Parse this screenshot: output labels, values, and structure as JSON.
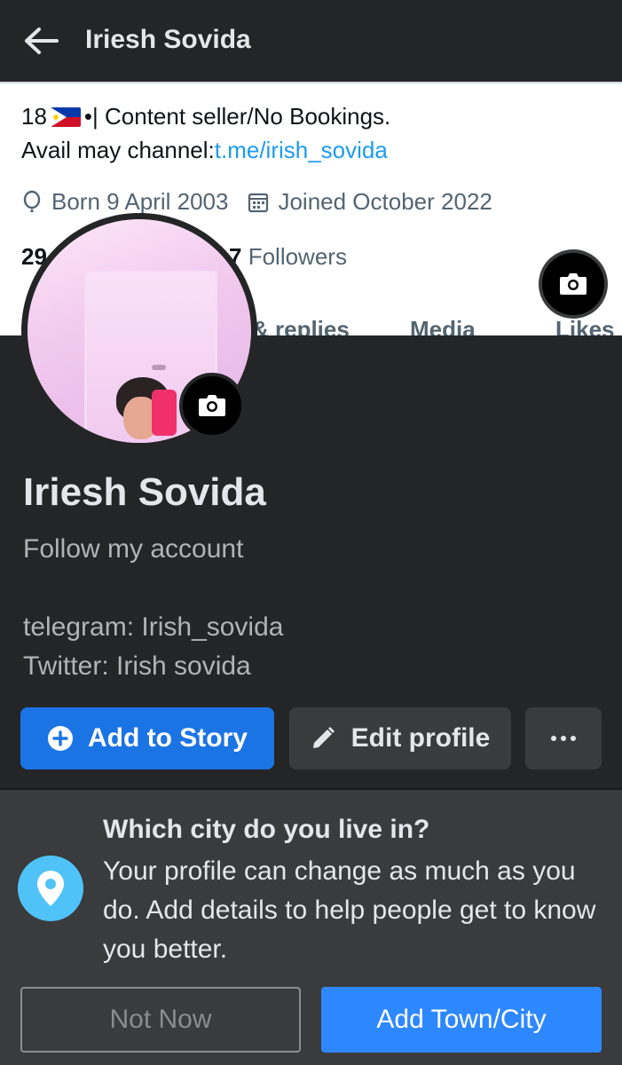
{
  "header": {
    "title": "Iriesh Sovida"
  },
  "twitter_embed": {
    "bio_line1_prefix": "18",
    "bio_line1_suffix": "•| Content seller/No Bookings.",
    "bio_line2_text": "Avail may channel:",
    "bio_line2_link": "t.me/irish_sovida",
    "born": "Born 9 April 2003",
    "joined": "Joined October 2022",
    "following_partial": "29",
    "followers_count_partial": "7",
    "followers_label": "Followers",
    "tabs": [
      "& replies",
      "Media",
      "Likes"
    ]
  },
  "profile": {
    "name": "Iriesh Sovida",
    "bio": "Follow my account",
    "socials": [
      "telegram: Irish_sovida",
      "Twitter: Irish sovida"
    ]
  },
  "actions": {
    "add_story": "Add to Story",
    "edit_profile": "Edit profile",
    "more": "···"
  },
  "city_prompt": {
    "title": "Which city do you live in?",
    "body": "Your profile can change as much as you do. Add details to help people get to know you better.",
    "not_now": "Not Now",
    "add_town": "Add Town/City"
  },
  "colors": {
    "background": "#242526",
    "primary_blue": "#1b74e4",
    "card": "#3a3b3c",
    "pin": "#4fc3f7"
  },
  "icons": [
    "back-arrow-icon",
    "balloon-icon",
    "calendar-icon",
    "camera-icon",
    "plus-circle-icon",
    "pencil-icon",
    "more-dots-icon",
    "location-pin-icon"
  ]
}
